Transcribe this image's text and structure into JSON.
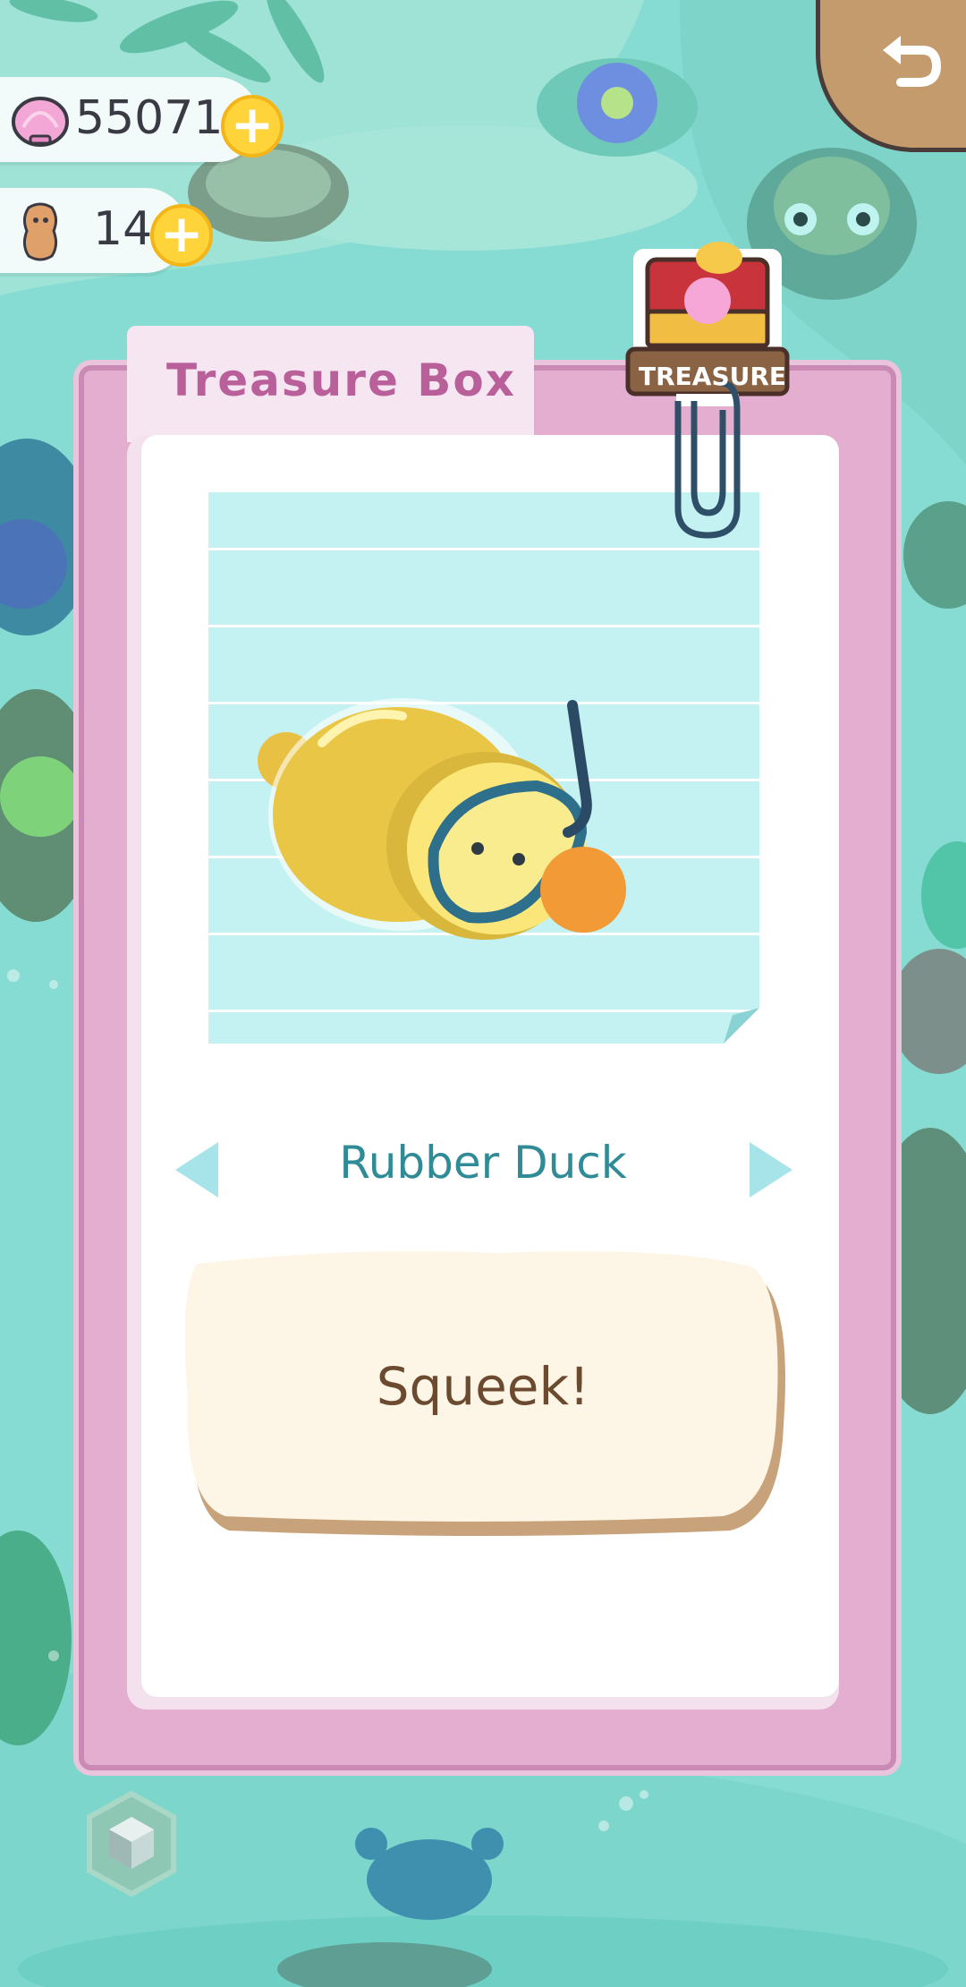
{
  "currency": {
    "shells": {
      "icon": "pink-shell-icon",
      "value": "55071"
    },
    "peanuts": {
      "icon": "peanut-icon",
      "value": "14"
    }
  },
  "header": {
    "back_icon": "undo-arrow-icon"
  },
  "panel": {
    "tab_title": "Treasure Box",
    "badge_label": "TREASURE",
    "item": {
      "name": "Rubber Duck",
      "description": "Squeek!",
      "image_icon": "rubber-duck-snorkel-icon"
    },
    "prev_icon": "left-triangle-icon",
    "next_icon": "right-triangle-icon"
  },
  "footer": {
    "cube_icon": "hexagon-cube-icon"
  },
  "colors": {
    "background": "#7fd8cf",
    "panel_frame": "#e4aed0",
    "tab_text": "#b95f9a",
    "item_name": "#2f8b96",
    "description_text": "#6b4a2f",
    "coin": "#ffd43a"
  }
}
